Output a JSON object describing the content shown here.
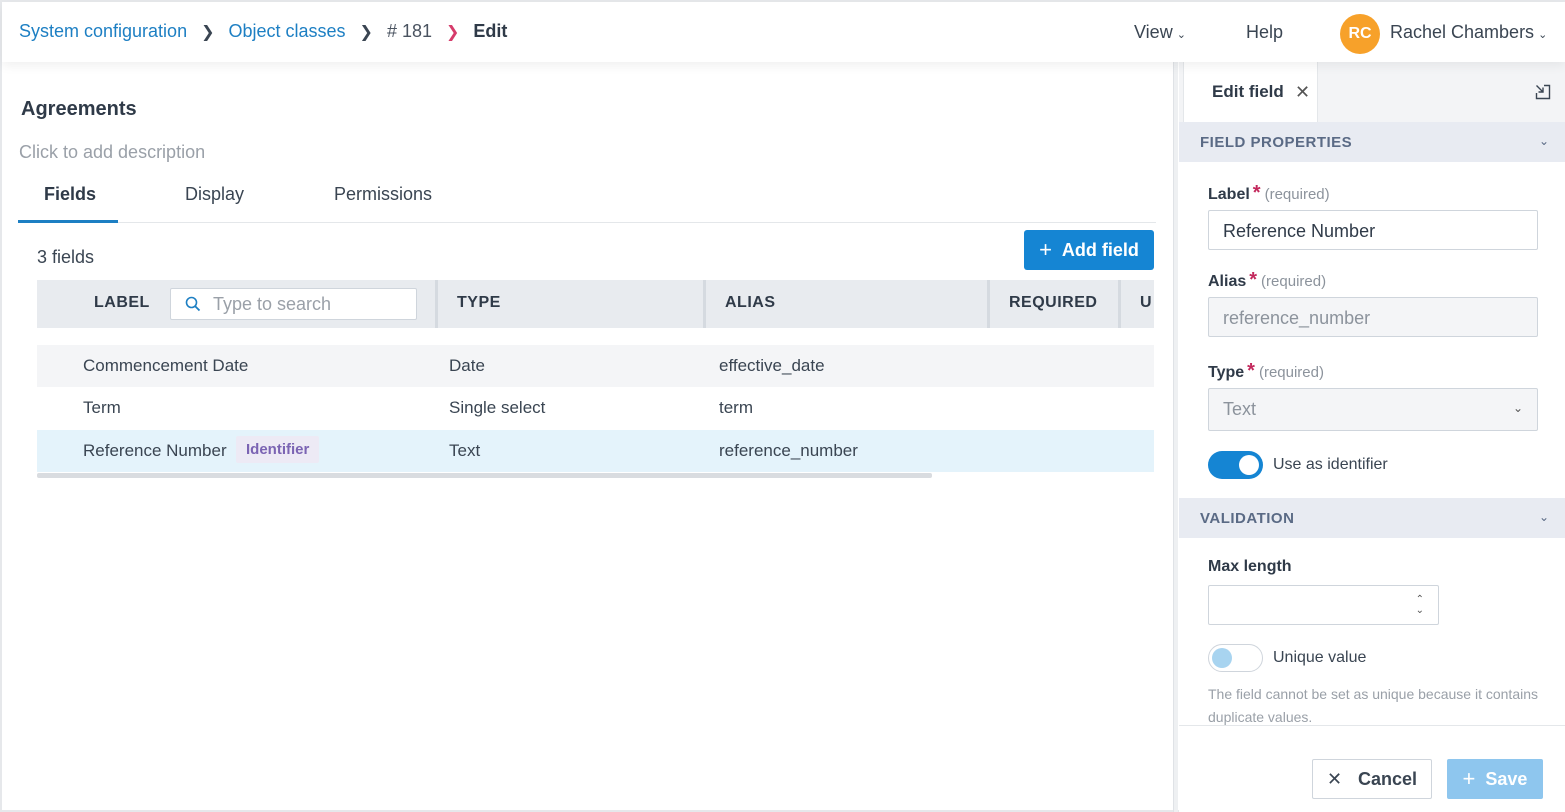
{
  "breadcrumb": {
    "items": [
      {
        "label": "System configuration"
      },
      {
        "label": "Object classes"
      },
      {
        "label": "# 181"
      },
      {
        "label": "Edit"
      }
    ]
  },
  "topnav": {
    "view_label": "View",
    "help_label": "Help",
    "user_initials": "RC",
    "user_name": "Rachel Chambers",
    "avatar_color": "#f7a12a"
  },
  "page": {
    "title": "Agreements",
    "description_placeholder": "Click to add description"
  },
  "tabs": [
    {
      "label": "Fields",
      "active": true
    },
    {
      "label": "Display",
      "active": false
    },
    {
      "label": "Permissions",
      "active": false
    }
  ],
  "fields_table": {
    "count_label": "3 fields",
    "add_button_label": "Add field",
    "search_placeholder": "Type to search",
    "columns": [
      "LABEL",
      "TYPE",
      "ALIAS",
      "REQUIRED",
      "U"
    ],
    "rows": [
      {
        "label": "Commencement Date",
        "type": "Date",
        "alias": "effective_date",
        "badge": ""
      },
      {
        "label": "Term",
        "type": "Single select",
        "alias": "term",
        "badge": ""
      },
      {
        "label": "Reference Number",
        "type": "Text",
        "alias": "reference_number",
        "badge": "Identifier"
      }
    ]
  },
  "panel": {
    "tab_label": "Edit field",
    "field_properties": {
      "heading": "FIELD PROPERTIES",
      "label_label": "Label",
      "label_value": "Reference Number",
      "alias_label": "Alias",
      "alias_value": "reference_number",
      "type_label": "Type",
      "type_value": "Text",
      "required_text": "(required)",
      "identifier_label": "Use as identifier",
      "identifier_on": true
    },
    "validation": {
      "heading": "VALIDATION",
      "max_length_label": "Max length",
      "max_length_value": "",
      "unique_label": "Unique value",
      "unique_on": false,
      "unique_hint": "The field cannot be set as unique because it contains duplicate values."
    },
    "cancel_label": "Cancel",
    "save_label": "Save"
  },
  "colors": {
    "accent": "#1585d3",
    "link": "#1d7fc3",
    "required_star": "#c3285c",
    "badge_text": "#7b64b3",
    "selected_row": "#e4f3fb"
  }
}
